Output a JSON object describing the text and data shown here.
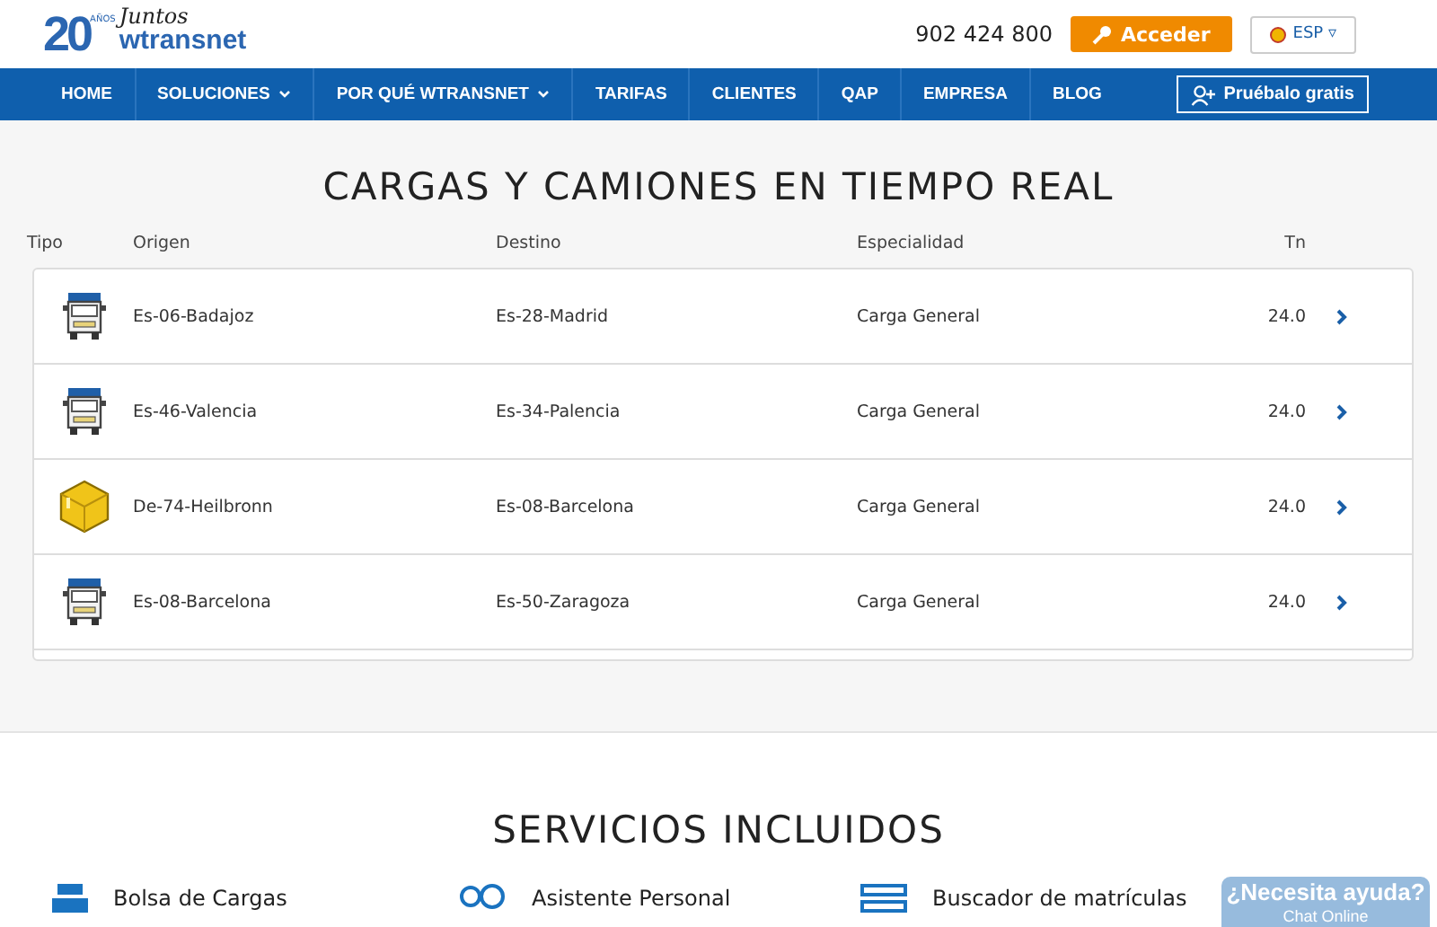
{
  "logo": {
    "number": "20",
    "years": "AÑOS",
    "tagline": "Juntos",
    "brand": "wtransnet"
  },
  "header": {
    "phone": "902 424 800",
    "login_button": "Acceder",
    "language": "ESP ▿"
  },
  "nav": {
    "items": [
      {
        "label": "HOME",
        "dropdown": false
      },
      {
        "label": "SOLUCIONES",
        "dropdown": true
      },
      {
        "label": "POR QUÉ WTRANSNET",
        "dropdown": true
      },
      {
        "label": "TARIFAS",
        "dropdown": false
      },
      {
        "label": "CLIENTES",
        "dropdown": false
      },
      {
        "label": "QAP",
        "dropdown": false
      },
      {
        "label": "EMPRESA",
        "dropdown": false
      },
      {
        "label": "BLOG",
        "dropdown": false
      }
    ],
    "trial_button": "Pruébalo gratis"
  },
  "realtime": {
    "title": "CARGAS Y CAMIONES EN TIEMPO REAL",
    "table": {
      "columns": [
        "Tipo",
        "Origen",
        "Destino",
        "Especialidad",
        "Tn"
      ],
      "rows": [
        {
          "kind": "truck",
          "origin": "Es-06-Badajoz",
          "destination": "Es-28-Madrid",
          "specialty": "Carga General",
          "tons": "24.0"
        },
        {
          "kind": "truck",
          "origin": "Es-46-Valencia",
          "destination": "Es-34-Palencia",
          "specialty": "Carga General",
          "tons": "24.0"
        },
        {
          "kind": "load",
          "origin": "De-74-Heilbronn",
          "destination": "Es-08-Barcelona",
          "specialty": "Carga General",
          "tons": "24.0"
        },
        {
          "kind": "truck",
          "origin": "Es-08-Barcelona",
          "destination": "Es-50-Zaragoza",
          "specialty": "Carga General",
          "tons": "24.0"
        }
      ]
    }
  },
  "services": {
    "title": "SERVICIOS INCLUIDOS",
    "items": [
      {
        "kind": "cargo",
        "label": "Bolsa de Cargas"
      },
      {
        "kind": "assistant",
        "label": "Asistente Personal"
      },
      {
        "kind": "search",
        "label": "Buscador de matrículas"
      }
    ]
  },
  "chat": {
    "title": "¿Necesita ayuda?",
    "subtitle": "Chat Online"
  }
}
